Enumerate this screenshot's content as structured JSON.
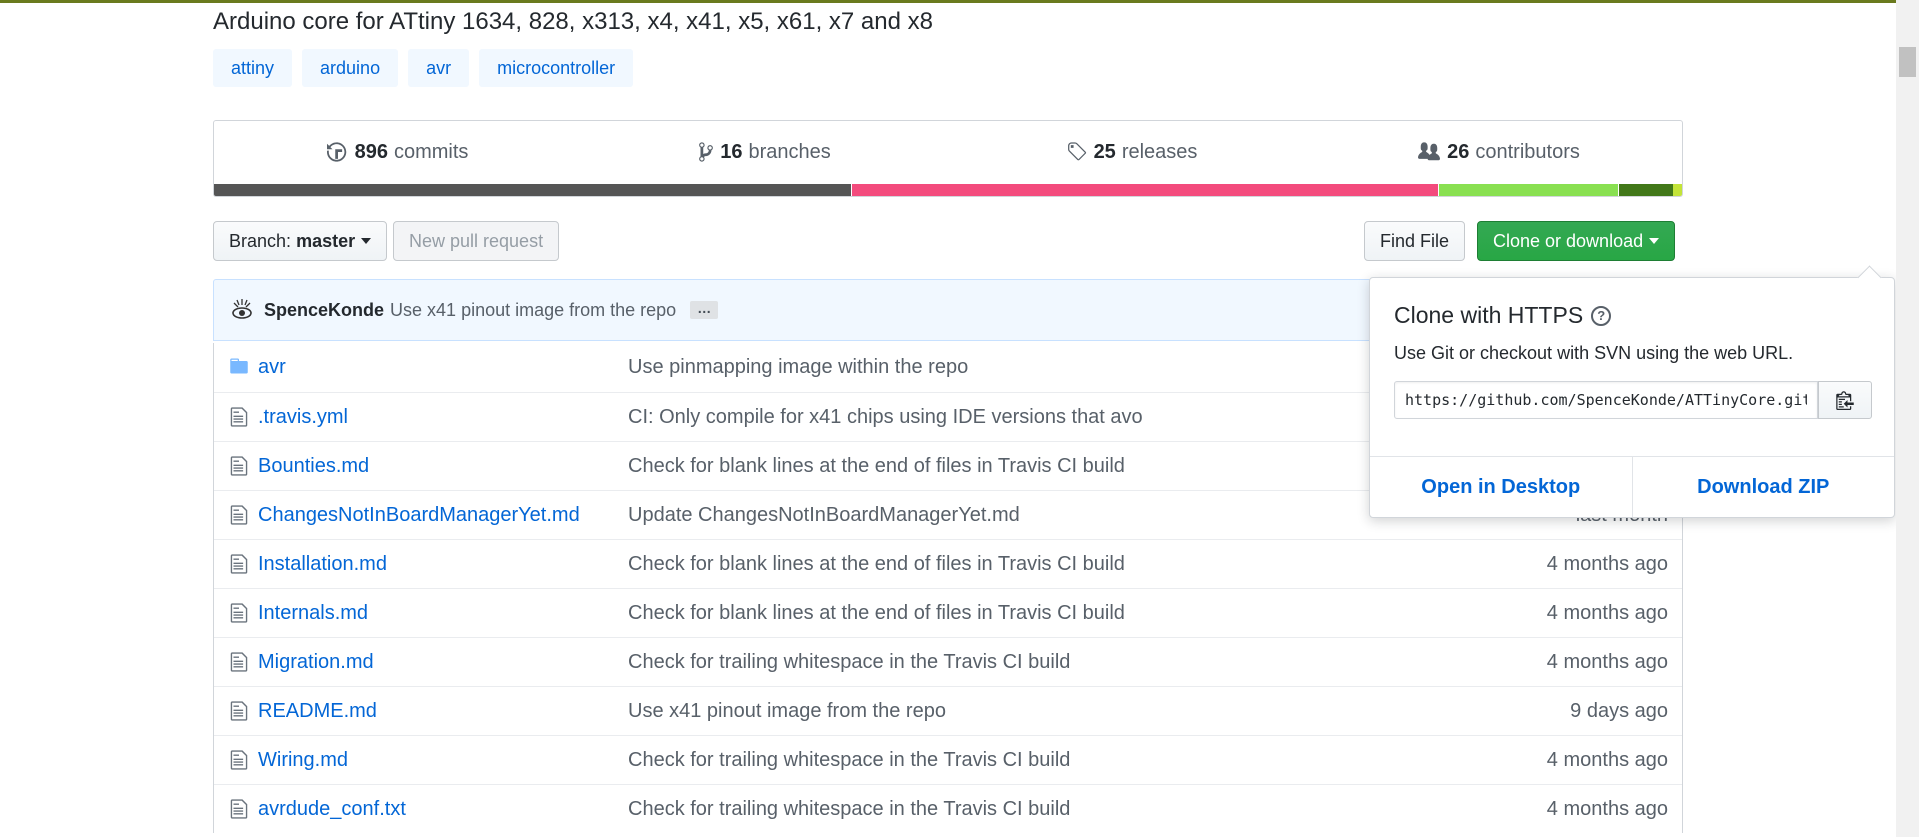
{
  "repo": {
    "description": "Arduino core for ATtiny 1634, 828, x313, x4, x41, x5, x61, x7 and x8",
    "topics": [
      "attiny",
      "arduino",
      "avr",
      "microcontroller"
    ]
  },
  "summary": {
    "commits": {
      "count": "896",
      "label": "commits",
      "icon": "history-icon"
    },
    "branches": {
      "count": "16",
      "label": "branches",
      "icon": "git-branch-icon"
    },
    "releases": {
      "count": "25",
      "label": "releases",
      "icon": "tag-icon"
    },
    "contributors": {
      "count": "26",
      "label": "contributors",
      "icon": "people-icon"
    },
    "language_colors": [
      "#555555",
      "#f34b7d",
      "#89e051",
      "#427819",
      "#c3e438"
    ]
  },
  "toolbar": {
    "branch_prefix": "Branch:",
    "branch_name": "master",
    "new_pull_request": "New pull request",
    "find_file": "Find File",
    "clone_or_download": "Clone or download"
  },
  "latest_commit": {
    "author": "SpenceKonde",
    "message": "Use x41 pinout image from the repo",
    "ellipsis": "…"
  },
  "files": [
    {
      "name": "avr",
      "type": "directory",
      "message": "Use pinmapping image within the repo",
      "age": ""
    },
    {
      "name": ".travis.yml",
      "type": "file",
      "message": "CI: Only compile for x41 chips using IDE versions that avo",
      "age": ""
    },
    {
      "name": "Bounties.md",
      "type": "file",
      "message": "Check for blank lines at the end of files in Travis CI build",
      "age": ""
    },
    {
      "name": "ChangesNotInBoardManagerYet.md",
      "type": "file",
      "message": "Update ChangesNotInBoardManagerYet.md",
      "age": "last month"
    },
    {
      "name": "Installation.md",
      "type": "file",
      "message": "Check for blank lines at the end of files in Travis CI build",
      "age": "4 months ago"
    },
    {
      "name": "Internals.md",
      "type": "file",
      "message": "Check for blank lines at the end of files in Travis CI build",
      "age": "4 months ago"
    },
    {
      "name": "Migration.md",
      "type": "file",
      "message": "Check for trailing whitespace in the Travis CI build",
      "age": "4 months ago"
    },
    {
      "name": "README.md",
      "type": "file",
      "message": "Use x41 pinout image from the repo",
      "age": "9 days ago"
    },
    {
      "name": "Wiring.md",
      "type": "file",
      "message": "Check for trailing whitespace in the Travis CI build",
      "age": "4 months ago"
    },
    {
      "name": "avrdude_conf.txt",
      "type": "file",
      "message": "Check for trailing whitespace in the Travis CI build",
      "age": "4 months ago"
    }
  ],
  "clone_popover": {
    "title": "Clone with HTTPS",
    "help_icon": "?",
    "description": "Use Git or checkout with SVN using the web URL.",
    "url": "https://github.com/SpenceKonde/ATTinyCore.git",
    "copy_icon": "clippy-icon",
    "open_desktop": "Open in Desktop",
    "download_zip": "Download ZIP"
  }
}
